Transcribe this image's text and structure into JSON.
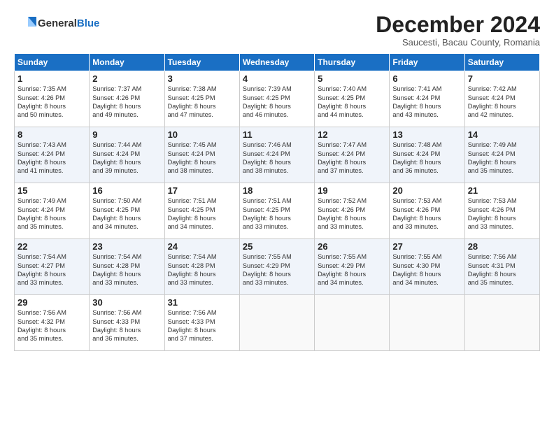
{
  "header": {
    "logo_general": "General",
    "logo_blue": "Blue",
    "month": "December 2024",
    "location": "Saucesti, Bacau County, Romania"
  },
  "weekdays": [
    "Sunday",
    "Monday",
    "Tuesday",
    "Wednesday",
    "Thursday",
    "Friday",
    "Saturday"
  ],
  "weeks": [
    [
      {
        "day": "1",
        "sunrise": "7:35 AM",
        "sunset": "4:26 PM",
        "daylight": "8 hours and 50 minutes."
      },
      {
        "day": "2",
        "sunrise": "7:37 AM",
        "sunset": "4:26 PM",
        "daylight": "8 hours and 49 minutes."
      },
      {
        "day": "3",
        "sunrise": "7:38 AM",
        "sunset": "4:25 PM",
        "daylight": "8 hours and 47 minutes."
      },
      {
        "day": "4",
        "sunrise": "7:39 AM",
        "sunset": "4:25 PM",
        "daylight": "8 hours and 46 minutes."
      },
      {
        "day": "5",
        "sunrise": "7:40 AM",
        "sunset": "4:25 PM",
        "daylight": "8 hours and 44 minutes."
      },
      {
        "day": "6",
        "sunrise": "7:41 AM",
        "sunset": "4:24 PM",
        "daylight": "8 hours and 43 minutes."
      },
      {
        "day": "7",
        "sunrise": "7:42 AM",
        "sunset": "4:24 PM",
        "daylight": "8 hours and 42 minutes."
      }
    ],
    [
      {
        "day": "8",
        "sunrise": "7:43 AM",
        "sunset": "4:24 PM",
        "daylight": "8 hours and 41 minutes."
      },
      {
        "day": "9",
        "sunrise": "7:44 AM",
        "sunset": "4:24 PM",
        "daylight": "8 hours and 39 minutes."
      },
      {
        "day": "10",
        "sunrise": "7:45 AM",
        "sunset": "4:24 PM",
        "daylight": "8 hours and 38 minutes."
      },
      {
        "day": "11",
        "sunrise": "7:46 AM",
        "sunset": "4:24 PM",
        "daylight": "8 hours and 38 minutes."
      },
      {
        "day": "12",
        "sunrise": "7:47 AM",
        "sunset": "4:24 PM",
        "daylight": "8 hours and 37 minutes."
      },
      {
        "day": "13",
        "sunrise": "7:48 AM",
        "sunset": "4:24 PM",
        "daylight": "8 hours and 36 minutes."
      },
      {
        "day": "14",
        "sunrise": "7:49 AM",
        "sunset": "4:24 PM",
        "daylight": "8 hours and 35 minutes."
      }
    ],
    [
      {
        "day": "15",
        "sunrise": "7:49 AM",
        "sunset": "4:24 PM",
        "daylight": "8 hours and 35 minutes."
      },
      {
        "day": "16",
        "sunrise": "7:50 AM",
        "sunset": "4:25 PM",
        "daylight": "8 hours and 34 minutes."
      },
      {
        "day": "17",
        "sunrise": "7:51 AM",
        "sunset": "4:25 PM",
        "daylight": "8 hours and 34 minutes."
      },
      {
        "day": "18",
        "sunrise": "7:51 AM",
        "sunset": "4:25 PM",
        "daylight": "8 hours and 33 minutes."
      },
      {
        "day": "19",
        "sunrise": "7:52 AM",
        "sunset": "4:26 PM",
        "daylight": "8 hours and 33 minutes."
      },
      {
        "day": "20",
        "sunrise": "7:53 AM",
        "sunset": "4:26 PM",
        "daylight": "8 hours and 33 minutes."
      },
      {
        "day": "21",
        "sunrise": "7:53 AM",
        "sunset": "4:26 PM",
        "daylight": "8 hours and 33 minutes."
      }
    ],
    [
      {
        "day": "22",
        "sunrise": "7:54 AM",
        "sunset": "4:27 PM",
        "daylight": "8 hours and 33 minutes."
      },
      {
        "day": "23",
        "sunrise": "7:54 AM",
        "sunset": "4:28 PM",
        "daylight": "8 hours and 33 minutes."
      },
      {
        "day": "24",
        "sunrise": "7:54 AM",
        "sunset": "4:28 PM",
        "daylight": "8 hours and 33 minutes."
      },
      {
        "day": "25",
        "sunrise": "7:55 AM",
        "sunset": "4:29 PM",
        "daylight": "8 hours and 33 minutes."
      },
      {
        "day": "26",
        "sunrise": "7:55 AM",
        "sunset": "4:29 PM",
        "daylight": "8 hours and 34 minutes."
      },
      {
        "day": "27",
        "sunrise": "7:55 AM",
        "sunset": "4:30 PM",
        "daylight": "8 hours and 34 minutes."
      },
      {
        "day": "28",
        "sunrise": "7:56 AM",
        "sunset": "4:31 PM",
        "daylight": "8 hours and 35 minutes."
      }
    ],
    [
      {
        "day": "29",
        "sunrise": "7:56 AM",
        "sunset": "4:32 PM",
        "daylight": "8 hours and 35 minutes."
      },
      {
        "day": "30",
        "sunrise": "7:56 AM",
        "sunset": "4:33 PM",
        "daylight": "8 hours and 36 minutes."
      },
      {
        "day": "31",
        "sunrise": "7:56 AM",
        "sunset": "4:33 PM",
        "daylight": "8 hours and 37 minutes."
      },
      null,
      null,
      null,
      null
    ]
  ],
  "labels": {
    "sunrise": "Sunrise:",
    "sunset": "Sunset:",
    "daylight": "Daylight:"
  }
}
